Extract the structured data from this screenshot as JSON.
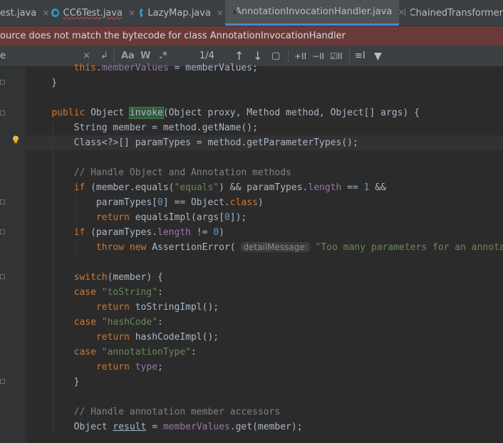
{
  "tabs": [
    {
      "label": "est.java",
      "close": "×",
      "icon": "none",
      "error": false,
      "active": false
    },
    {
      "label": "CC6Test.java",
      "close": "×",
      "icon": "class-icon",
      "error": true,
      "active": false
    },
    {
      "label": "LazyMap.java",
      "close": "×",
      "icon": "class-icon",
      "error": false,
      "active": false
    },
    {
      "label": "AnnotationInvocationHandler.java",
      "close": "×",
      "icon": "class-icon",
      "error": false,
      "active": true
    },
    {
      "label": "ChainedTransformer",
      "close": "",
      "icon": "class-icon",
      "error": false,
      "active": false
    }
  ],
  "banner": {
    "text": "ource does not match the bytecode for class AnnotationInvocationHandler",
    "color": "#6a3a3a"
  },
  "find": {
    "query": "e",
    "clear": "×",
    "regex_toggle": "↲",
    "match_case": "Aa",
    "words": "W",
    "regex": ".*",
    "count": "1/4",
    "prev": "↑",
    "next": "↓",
    "select_all": "▢",
    "add_cursor": "+II",
    "remove_cursor": "−II",
    "select_all_occ": "☑II",
    "context": "≡I",
    "filter": "▼"
  },
  "code": {
    "lines": [
      [
        {
          "t": "        "
        },
        {
          "t": "this",
          "c": "kw"
        },
        {
          "t": "."
        },
        {
          "t": "memberValues",
          "c": "fld"
        },
        {
          "t": " = memberValues;"
        }
      ],
      [
        {
          "t": "    }"
        }
      ],
      [
        {
          "t": ""
        }
      ],
      [
        {
          "t": "    "
        },
        {
          "t": "public",
          "c": "kw"
        },
        {
          "t": " Object "
        },
        {
          "t": "invoke",
          "c": "hl"
        },
        {
          "t": "(Object proxy, Method method, Object[] args) {"
        }
      ],
      [
        {
          "t": "        String member = method.getName();"
        }
      ],
      [
        {
          "t": "        Class<?>[] paramTypes = method.getParameterTypes();"
        }
      ],
      [
        {
          "t": ""
        }
      ],
      [
        {
          "t": "        "
        },
        {
          "t": "// Handle Object and Annotation methods",
          "c": "cmt"
        }
      ],
      [
        {
          "t": "        "
        },
        {
          "t": "if",
          "c": "kw"
        },
        {
          "t": " (member.equals("
        },
        {
          "t": "\"equals\"",
          "c": "str"
        },
        {
          "t": ") && paramTypes."
        },
        {
          "t": "length",
          "c": "fld"
        },
        {
          "t": " == "
        },
        {
          "t": "1",
          "c": "num"
        },
        {
          "t": " &&"
        }
      ],
      [
        {
          "t": "            paramTypes["
        },
        {
          "t": "0",
          "c": "num"
        },
        {
          "t": "] == Object."
        },
        {
          "t": "class",
          "c": "kw"
        },
        {
          "t": ")"
        }
      ],
      [
        {
          "t": "            "
        },
        {
          "t": "return",
          "c": "kw"
        },
        {
          "t": " equalsImpl(args["
        },
        {
          "t": "0",
          "c": "num"
        },
        {
          "t": "]);"
        }
      ],
      [
        {
          "t": "        "
        },
        {
          "t": "if",
          "c": "kw"
        },
        {
          "t": " (paramTypes."
        },
        {
          "t": "length",
          "c": "fld"
        },
        {
          "t": " != "
        },
        {
          "t": "0",
          "c": "num"
        },
        {
          "t": ")"
        }
      ],
      [
        {
          "t": "            "
        },
        {
          "t": "throw",
          "c": "kw"
        },
        {
          "t": " "
        },
        {
          "t": "new",
          "c": "kw"
        },
        {
          "t": " AssertionError( "
        },
        {
          "t": "detailMessage:",
          "c": "hint"
        },
        {
          "t": " "
        },
        {
          "t": "\"Too many parameters for an annotation",
          "c": "str"
        }
      ],
      [
        {
          "t": ""
        }
      ],
      [
        {
          "t": "        "
        },
        {
          "t": "switch",
          "c": "kw"
        },
        {
          "t": "(member) {"
        }
      ],
      [
        {
          "t": "        "
        },
        {
          "t": "case",
          "c": "kw"
        },
        {
          "t": " "
        },
        {
          "t": "\"toString\"",
          "c": "str"
        },
        {
          "t": ":"
        }
      ],
      [
        {
          "t": "            "
        },
        {
          "t": "return",
          "c": "kw"
        },
        {
          "t": " toStringImpl();"
        }
      ],
      [
        {
          "t": "        "
        },
        {
          "t": "case",
          "c": "kw"
        },
        {
          "t": " "
        },
        {
          "t": "\"hashCode\"",
          "c": "str"
        },
        {
          "t": ":"
        }
      ],
      [
        {
          "t": "            "
        },
        {
          "t": "return",
          "c": "kw"
        },
        {
          "t": " hashCodeImpl();"
        }
      ],
      [
        {
          "t": "        "
        },
        {
          "t": "case",
          "c": "kw"
        },
        {
          "t": " "
        },
        {
          "t": "\"annotationType\"",
          "c": "str"
        },
        {
          "t": ":"
        }
      ],
      [
        {
          "t": "            "
        },
        {
          "t": "return",
          "c": "kw"
        },
        {
          "t": " "
        },
        {
          "t": "type",
          "c": "fld"
        },
        {
          "t": ";"
        }
      ],
      [
        {
          "t": "        }"
        }
      ],
      [
        {
          "t": ""
        }
      ],
      [
        {
          "t": "        "
        },
        {
          "t": "// Handle annotation member accessors",
          "c": "cmt"
        }
      ],
      [
        {
          "t": "        Object "
        },
        {
          "t": "result",
          "c": "ul"
        },
        {
          "t": " = "
        },
        {
          "t": "memberValues",
          "c": "fld"
        },
        {
          "t": ".get(member);"
        }
      ]
    ]
  },
  "colors": {
    "background": "#2b2b2b",
    "keyword": "#cc7832",
    "string": "#6a8759",
    "number": "#6897bb",
    "field": "#9876aa",
    "comment": "#808080"
  }
}
